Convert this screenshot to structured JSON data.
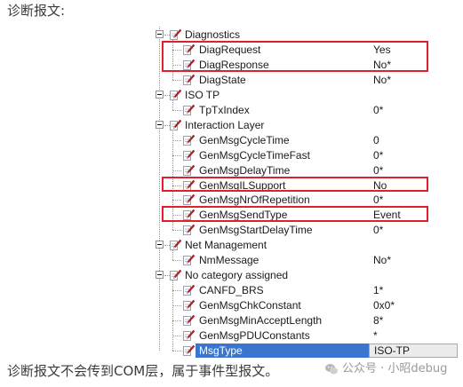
{
  "captions": {
    "top": "诊断报文:",
    "bottom": "诊断报文不会传到COM层，属于事件型报文。"
  },
  "watermark": "公众号 · 小昭debug",
  "colors": {
    "highlight": "#e0202a",
    "selection": "#3a76d0"
  },
  "tree": {
    "rows": [
      {
        "kind": "category",
        "name": "Diagnostics",
        "value": ""
      },
      {
        "kind": "attribute",
        "name": "DiagRequest",
        "value": "Yes"
      },
      {
        "kind": "attribute",
        "name": "DiagResponse",
        "value": "No*"
      },
      {
        "kind": "attribute",
        "name": "DiagState",
        "value": "No*"
      },
      {
        "kind": "category",
        "name": "ISO TP",
        "value": ""
      },
      {
        "kind": "attribute",
        "name": "TpTxIndex",
        "value": "0*"
      },
      {
        "kind": "category",
        "name": "Interaction Layer",
        "value": ""
      },
      {
        "kind": "attribute",
        "name": "GenMsgCycleTime",
        "value": "0"
      },
      {
        "kind": "attribute",
        "name": "GenMsgCycleTimeFast",
        "value": "0*"
      },
      {
        "kind": "attribute",
        "name": "GenMsgDelayTime",
        "value": "0*"
      },
      {
        "kind": "attribute",
        "name": "GenMsgILSupport",
        "value": "No"
      },
      {
        "kind": "attribute",
        "name": "GenMsgNrOfRepetition",
        "value": "0*"
      },
      {
        "kind": "attribute",
        "name": "GenMsgSendType",
        "value": "Event"
      },
      {
        "kind": "attribute",
        "name": "GenMsgStartDelayTime",
        "value": "0*"
      },
      {
        "kind": "category",
        "name": "Net Management",
        "value": ""
      },
      {
        "kind": "attribute",
        "name": "NmMessage",
        "value": "No*"
      },
      {
        "kind": "category",
        "name": "No category assigned",
        "value": ""
      },
      {
        "kind": "attribute",
        "name": "CANFD_BRS",
        "value": "1*"
      },
      {
        "kind": "attribute",
        "name": "GenMsgChkConstant",
        "value": "0x0*"
      },
      {
        "kind": "attribute",
        "name": "GenMsgMinAcceptLength",
        "value": "8*"
      },
      {
        "kind": "attribute",
        "name": "GenMsgPDUConstants",
        "value": "*"
      },
      {
        "kind": "attribute",
        "name": "MsgType",
        "value": "ISO-TP",
        "selected": true
      }
    ]
  }
}
